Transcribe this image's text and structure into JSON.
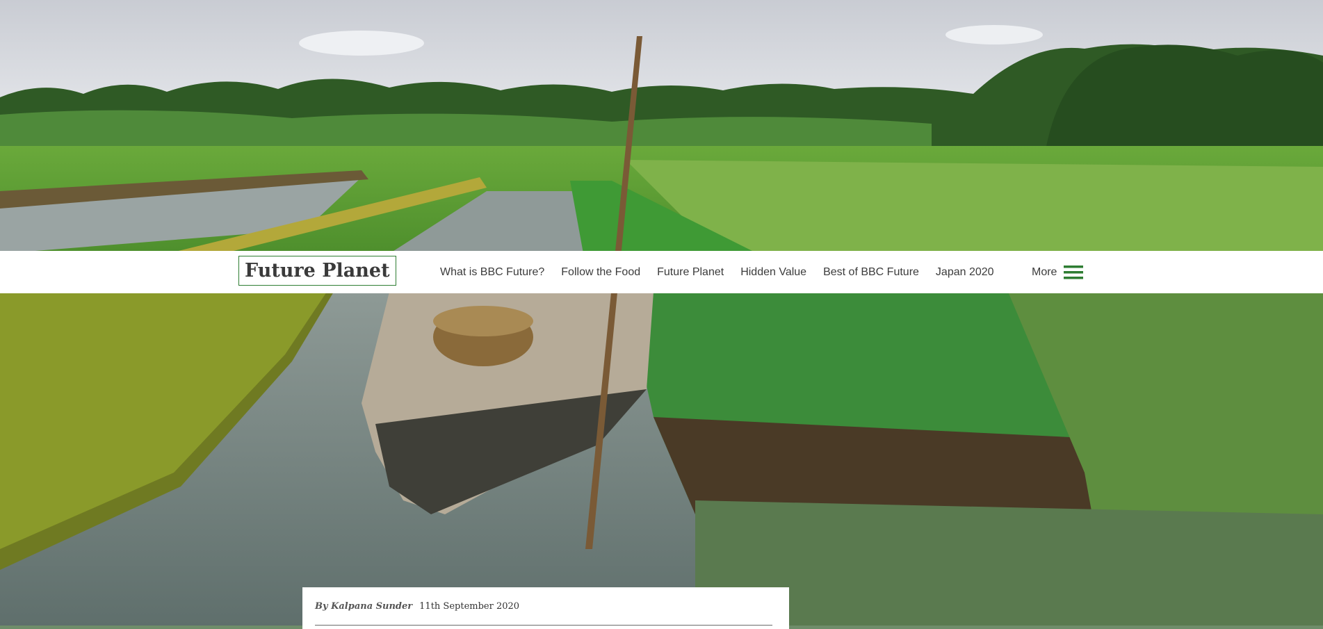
{
  "brand": {
    "title": "Future Planet"
  },
  "nav": {
    "links": [
      {
        "label": "What is BBC Future?"
      },
      {
        "label": "Follow the Food"
      },
      {
        "label": "Future Planet"
      },
      {
        "label": "Hidden Value"
      },
      {
        "label": "Best of BBC Future"
      },
      {
        "label": "Japan 2020"
      }
    ],
    "more_label": "More",
    "more_icon": "hamburger-icon"
  },
  "article": {
    "author": "By Kalpana Sunder",
    "date": "11th September 2020"
  },
  "colors": {
    "accent": "#2e7d32",
    "nav_bg": "#ffffff",
    "text": "#3b3b3b"
  }
}
